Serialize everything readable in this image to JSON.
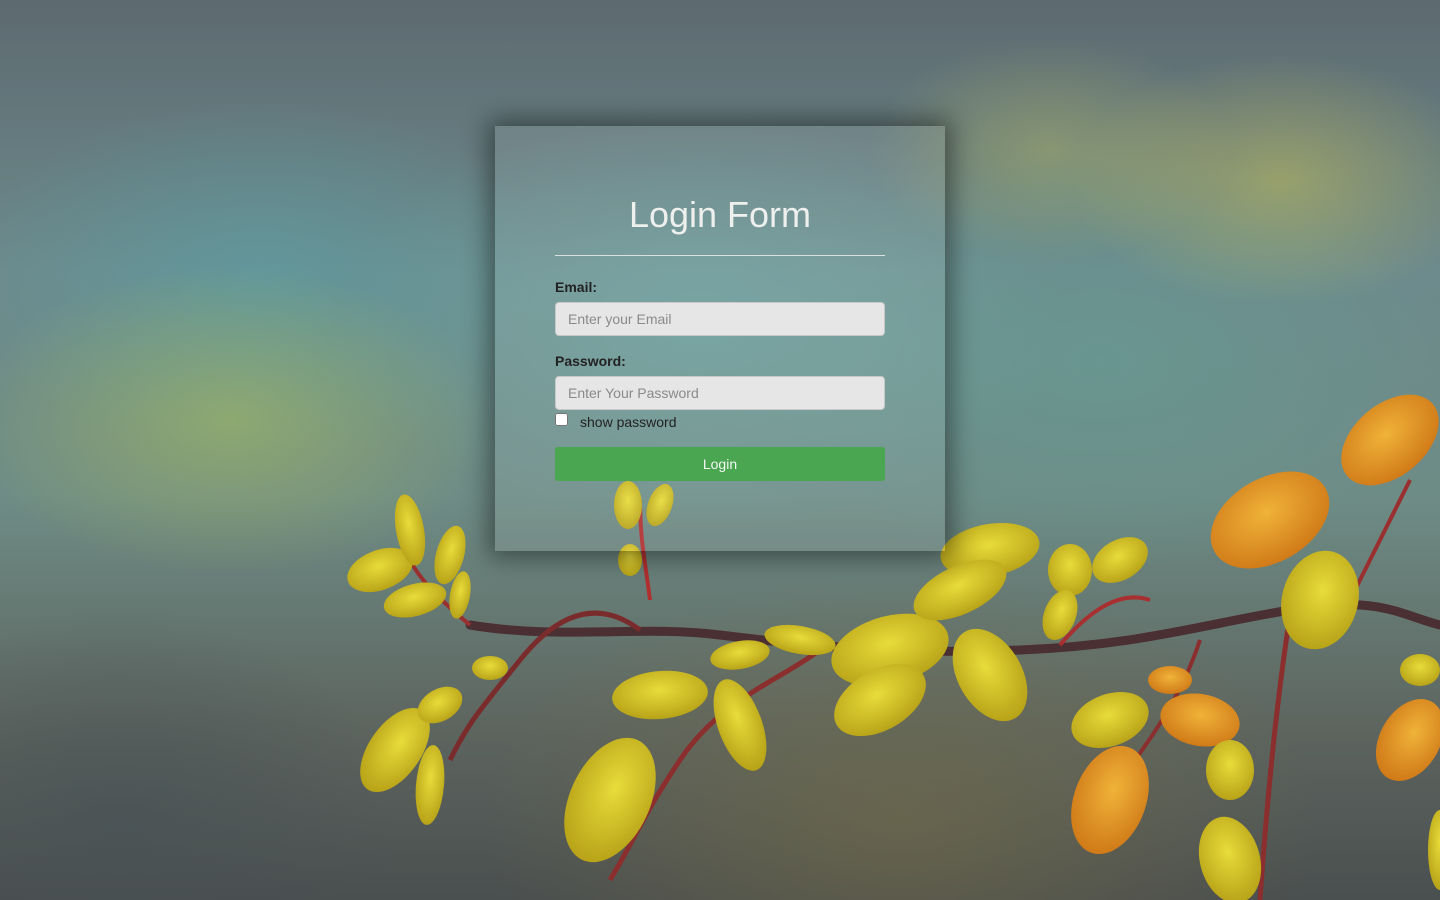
{
  "form": {
    "title": "Login Form",
    "email_label": "Email:",
    "email_placeholder": "Enter your Email",
    "email_value": "",
    "password_label": "Password:",
    "password_placeholder": "Enter Your Password",
    "password_value": "",
    "show_password_label": "show password",
    "show_password_checked": false,
    "login_label": "Login"
  },
  "colors": {
    "login_button": "#4ba651",
    "leaf_yellow": "#d6c21e",
    "leaf_orange": "#e39a1e",
    "branch": "#4a2f33"
  }
}
